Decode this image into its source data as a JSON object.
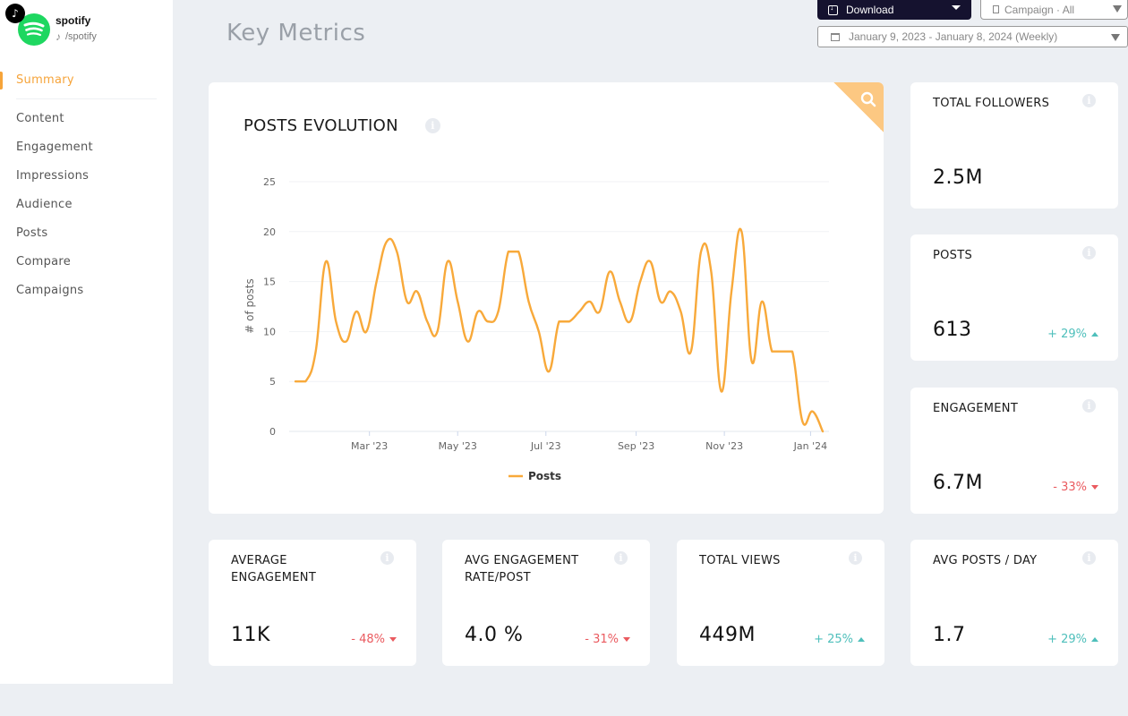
{
  "account": {
    "name": "spotify",
    "handle": "/spotify",
    "platform": "TikTok",
    "brand_color": "#1ed760"
  },
  "sidebar": {
    "items": [
      {
        "label": "Summary",
        "active": true
      },
      {
        "label": "Content"
      },
      {
        "label": "Engagement"
      },
      {
        "label": "Impressions"
      },
      {
        "label": "Audience"
      },
      {
        "label": "Posts"
      },
      {
        "label": "Compare"
      },
      {
        "label": "Campaigns"
      }
    ],
    "accent": "#f6a43a"
  },
  "header": {
    "title": "Key Metrics",
    "download_label": "Download",
    "campaign_label": "Campaign · All",
    "date_range": "January 9, 2023 - January 8, 2024 (Weekly)"
  },
  "chart_card": {
    "title": "POSTS EVOLUTION",
    "info": "i"
  },
  "chart_data": {
    "type": "line",
    "title": "POSTS EVOLUTION",
    "xlabel": "",
    "ylabel": "# of posts",
    "ylim": [
      0,
      25
    ],
    "yticks": [
      0,
      5,
      10,
      15,
      20,
      25
    ],
    "xticks": [
      {
        "label": "Mar '23",
        "index": 7.3
      },
      {
        "label": "May '23",
        "index": 16.0
      },
      {
        "label": "Jul '23",
        "index": 24.7
      },
      {
        "label": "Sep '23",
        "index": 33.6
      },
      {
        "label": "Nov '23",
        "index": 42.3
      },
      {
        "label": "Jan '24",
        "index": 50.8
      }
    ],
    "grid": true,
    "legend": "bottom-center",
    "series": [
      {
        "name": "Posts",
        "color": "#f8a93a",
        "values": [
          5,
          5,
          8,
          17,
          11,
          9,
          12,
          10,
          15,
          19,
          18,
          13,
          14,
          11,
          10,
          17,
          13,
          9,
          12,
          11,
          12,
          18,
          18,
          13,
          10,
          6,
          11,
          11,
          12,
          13,
          12,
          16,
          13,
          11,
          15,
          17,
          13,
          14,
          12,
          8,
          18,
          16,
          4,
          14,
          20,
          7,
          13,
          8,
          8,
          8,
          1,
          2,
          0
        ]
      }
    ]
  },
  "kpis": [
    {
      "title": "TOTAL FOLLOWERS",
      "value": "2.5M"
    },
    {
      "title": "POSTS",
      "value": "613",
      "delta": "+ 29%",
      "direction": "up"
    },
    {
      "title": "ENGAGEMENT",
      "value": "6.7M",
      "delta": "- 33%",
      "direction": "down"
    },
    {
      "title": "AVERAGE ENGAGEMENT",
      "value": "11K",
      "delta": "- 48%",
      "direction": "down"
    },
    {
      "title": "AVG ENGAGEMENT RATE/POST",
      "value": "4.0 %",
      "delta": "- 31%",
      "direction": "down"
    },
    {
      "title": "TOTAL VIEWS",
      "value": "449M",
      "delta": "+ 25%",
      "direction": "up"
    },
    {
      "title": "AVG POSTS / DAY",
      "value": "1.7",
      "delta": "+ 29%",
      "direction": "up"
    }
  ],
  "colors": {
    "positive": "#4ebfbb",
    "negative": "#ea5a5f",
    "line": "#f8a93a"
  }
}
